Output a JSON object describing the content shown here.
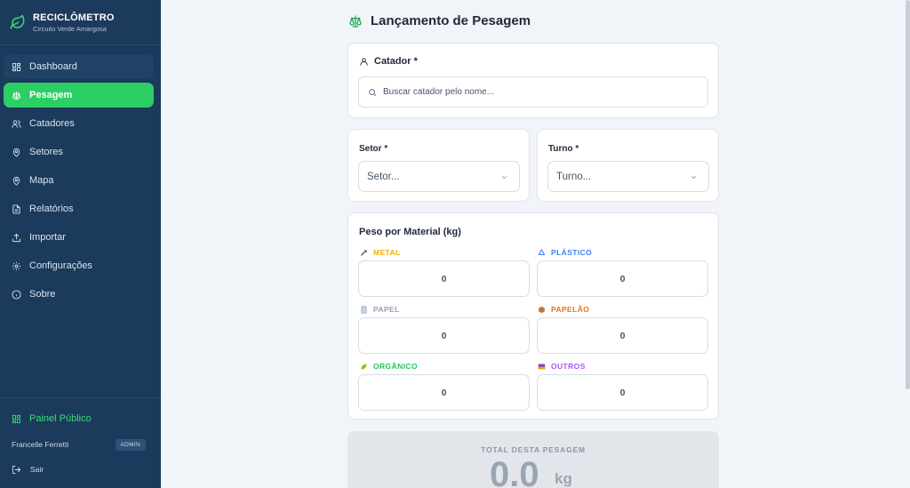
{
  "brand": {
    "title": "RECICLÔMETRO",
    "subtitle": "Circuito Verde Amargosa"
  },
  "sidebar": {
    "items": [
      {
        "label": "Dashboard"
      },
      {
        "label": "Pesagem"
      },
      {
        "label": "Catadores"
      },
      {
        "label": "Setores"
      },
      {
        "label": "Mapa"
      },
      {
        "label": "Relatórios"
      },
      {
        "label": "Importar"
      },
      {
        "label": "Configurações"
      },
      {
        "label": "Sobre"
      }
    ],
    "public_panel": "Painel Público",
    "user_name": "Francelle Ferretti",
    "user_role": "ADMIN",
    "logout": "Sair"
  },
  "page": {
    "title": "Lançamento de Pesagem"
  },
  "catador": {
    "label": "Catador *",
    "placeholder": "Buscar catador pelo nome..."
  },
  "setor": {
    "label": "Setor *",
    "value": "Setor..."
  },
  "turno": {
    "label": "Turno *",
    "value": "Turno..."
  },
  "materials": {
    "title": "Peso por Material (kg)",
    "items": [
      {
        "label": "METAL",
        "value": "0",
        "color": "#eab308"
      },
      {
        "label": "PLÁSTICO",
        "value": "0",
        "color": "#3b82f6"
      },
      {
        "label": "PAPEL",
        "value": "0",
        "color": "#94a3b8"
      },
      {
        "label": "PAPELÃO",
        "value": "0",
        "color": "#ea7317"
      },
      {
        "label": "ORGÂNICO",
        "value": "0",
        "color": "#22c55e"
      },
      {
        "label": "OUTROS",
        "value": "0",
        "color": "#a855f7"
      }
    ]
  },
  "total": {
    "label": "TOTAL DESTA PESAGEM",
    "value": "0.0",
    "unit": "kg"
  },
  "colors": {
    "sidebar_bg": "#1b3a5c",
    "accent": "#2dce63"
  }
}
